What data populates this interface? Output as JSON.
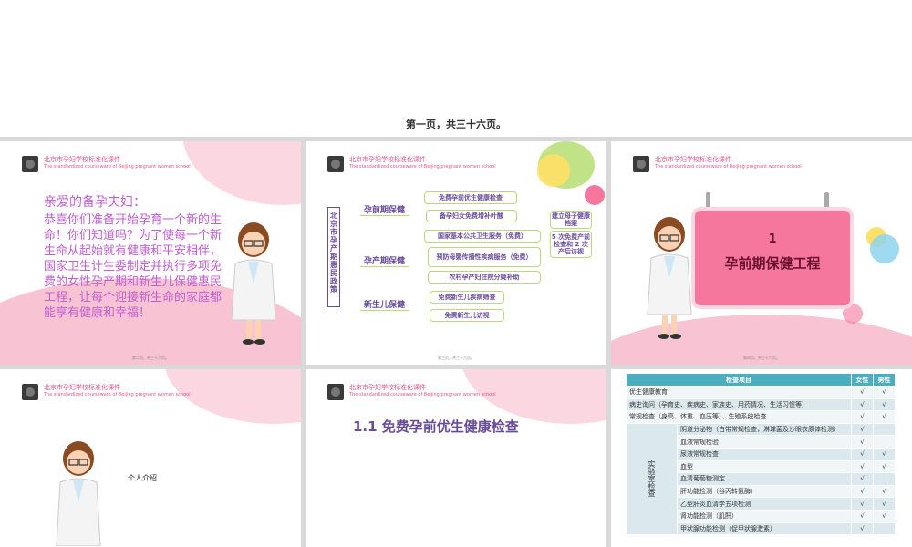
{
  "caption": "第一页，共三十六页。",
  "header": {
    "title_cn": "北京市孕妇学校标准化课件",
    "title_en": "The standardized courseware of Beijing pregnant women school"
  },
  "slide1": {
    "greeting": "亲爱的备孕夫妇：",
    "body": "恭喜你们准备开始孕育一个新的生命！你们知道吗？为了使每一个新生命从起始就有健康和平安相伴，国家卫生计生委制定并执行多项免费的女性孕产期和新生儿保健惠民工程，让每个迎接新生命的家庭都能享有健康和幸福！",
    "footer": "第二页，共三十六页。"
  },
  "slide2": {
    "vertical_title": "北京市孕产期惠民政策",
    "categories": [
      "孕前期保健",
      "孕产期保健",
      "新生儿保健"
    ],
    "items": [
      "免费孕前优生健康检查",
      "备孕妇女免费增补叶酸",
      "国家基本公共卫生服务（免费）",
      "预防母婴传播性疾病服务（免费）",
      "农村孕产妇住院分娩补助",
      "免费新生儿疾病筛查",
      "免费新生儿访视"
    ],
    "side_items": [
      "建立母子健康档案",
      "5 次免费产前检查和 2 次产后访视"
    ],
    "footer": "第三页，共三十六页。"
  },
  "slide3": {
    "number": "1",
    "title": "孕前期保健工程",
    "footer": "第四页，共三十六页。"
  },
  "slide4": {
    "intro": "个人介绍"
  },
  "slide5": {
    "heading": "1.1  免费孕前优生健康检查"
  },
  "slide6": {
    "headers": [
      "检查项目",
      "女性",
      "男性"
    ],
    "lab_label": "实验室检查",
    "rows": [
      {
        "item": "优生健康教育",
        "f": "√",
        "m": "√"
      },
      {
        "item": "病史询问（孕育史、疾病史、家族史、用药情况、生活习惯等）",
        "f": "√",
        "m": "√"
      },
      {
        "item": "常规检查（身高、体重、血压等）、生殖系统检查",
        "f": "√",
        "m": "√"
      }
    ],
    "lab_rows": [
      {
        "item": "阴道分泌物（白带常规检查，淋球菌及沙眼衣原体检测）",
        "f": "√",
        "m": ""
      },
      {
        "item": "血液常规检验",
        "f": "√",
        "m": ""
      },
      {
        "item": "尿液常规检查",
        "f": "√",
        "m": "√"
      },
      {
        "item": "血型",
        "f": "√",
        "m": "√"
      },
      {
        "item": "血清葡萄糖测定",
        "f": "√",
        "m": ""
      },
      {
        "item": "肝功能检测（谷丙转氨酶）",
        "f": "√",
        "m": "√"
      },
      {
        "item": "乙型肝炎血清学五项检测",
        "f": "√",
        "m": "√"
      },
      {
        "item": "肾功能检测（肌酐）",
        "f": "√",
        "m": "√"
      },
      {
        "item": "甲状腺功能检测（促甲状腺激素）",
        "f": "√",
        "m": ""
      }
    ]
  },
  "colors": {
    "accent_pink": "#e8568a",
    "purple": "#6a4c9c",
    "green_border": "#b9d97a",
    "table_header": "#4aaec0"
  }
}
